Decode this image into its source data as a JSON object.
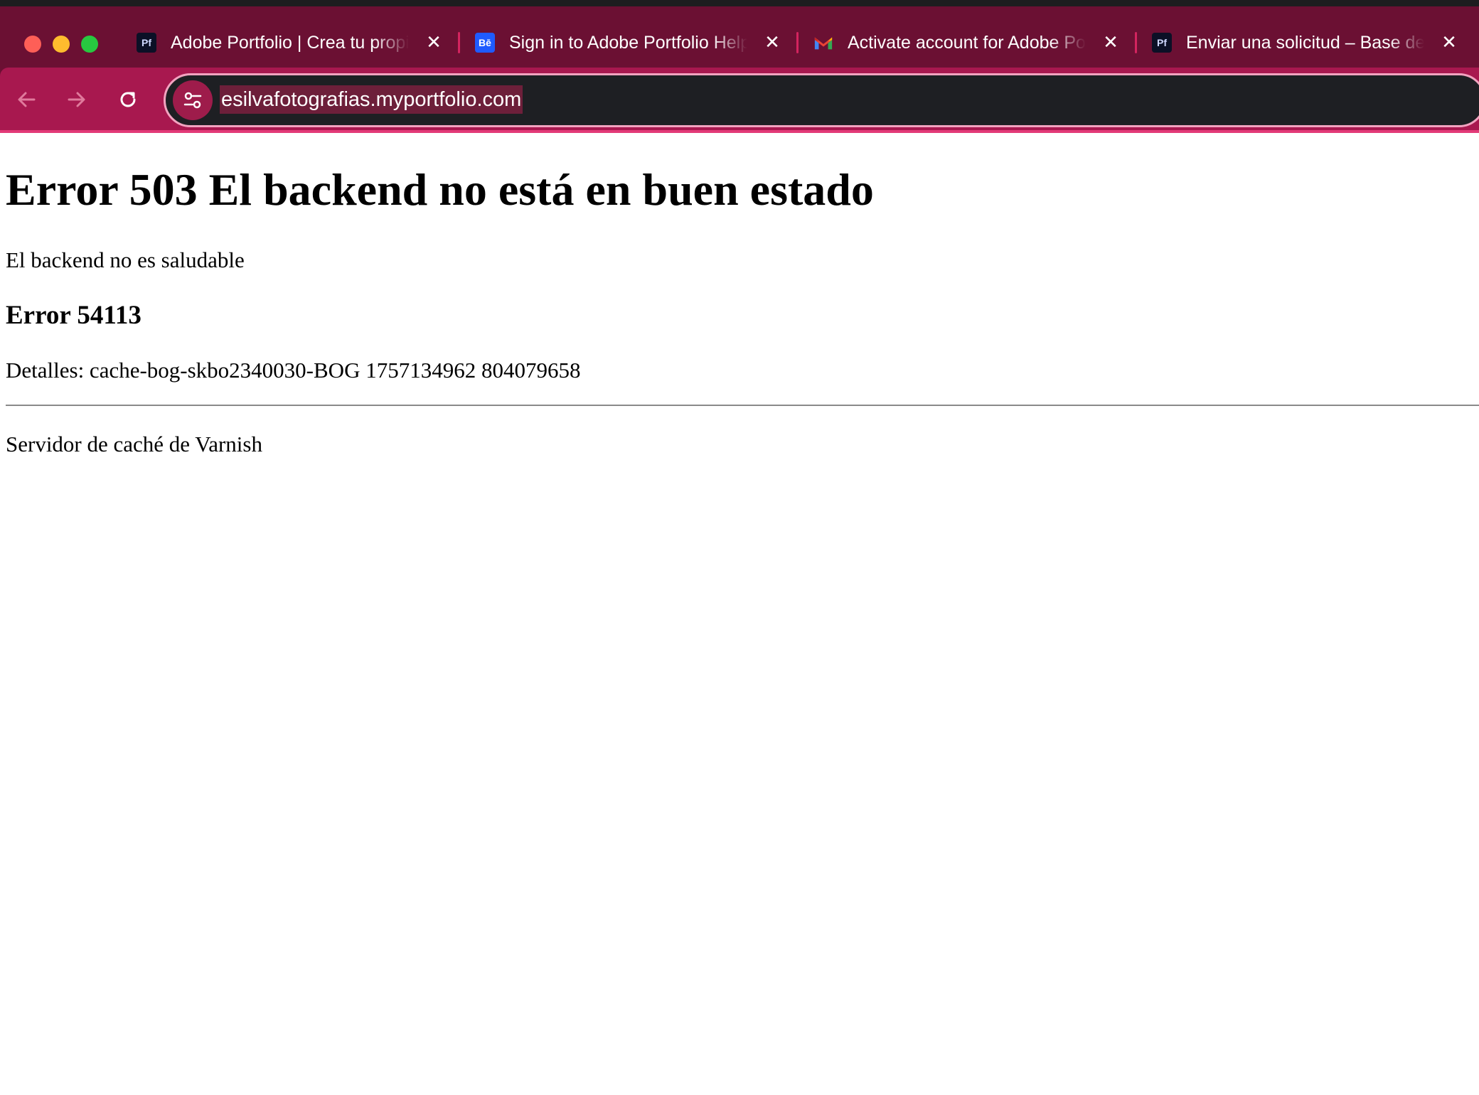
{
  "browser": {
    "colors": {
      "tab_bar": "#6b1033",
      "toolbar": "#a8184f",
      "omnibox": "#1e1f23",
      "close_red": "#fe5f57",
      "minimize_yellow": "#febc2e",
      "zoom_green": "#28c840"
    },
    "tabs": [
      {
        "favicon": "Pf",
        "favicon_icon": "adobe-portfolio-icon",
        "title": "Adobe Portfolio | Crea tu propio sitio web",
        "close": "✕"
      },
      {
        "favicon": "Bē",
        "favicon_icon": "behance-icon",
        "title": "Sign in to Adobe Portfolio Help",
        "close": "✕"
      },
      {
        "favicon": "",
        "favicon_icon": "gmail-icon",
        "title": "Activate account for Adobe Portfolio",
        "close": "✕"
      },
      {
        "favicon": "Pf",
        "favicon_icon": "adobe-portfolio-icon",
        "title": "Enviar una solicitud – Base de conocimientos",
        "close": "✕"
      }
    ],
    "toolbar": {
      "back_icon": "arrow-left-icon",
      "forward_icon": "arrow-right-icon",
      "reload_icon": "reload-icon",
      "site_info_icon": "tune-icon",
      "url": "esilvafotografias.myportfolio.com"
    }
  },
  "page": {
    "heading": "Error 503 El backend no está en buen estado",
    "message": "El backend no es saludable",
    "error_code": "Error 54113",
    "details": "Detalles: cache-bog-skbo2340030-BOG 1757134962 804079658",
    "footer": "Servidor de caché de Varnish"
  }
}
